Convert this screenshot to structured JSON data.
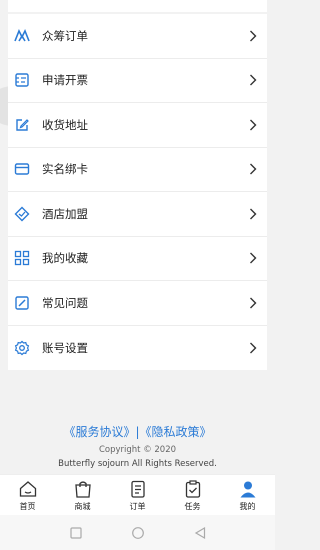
{
  "menu": {
    "items": [
      {
        "label": "众筹订单",
        "icon": "crowdfund-icon"
      },
      {
        "label": "申请开票",
        "icon": "invoice-icon"
      },
      {
        "label": "收货地址",
        "icon": "edit-address-icon"
      },
      {
        "label": "实名绑卡",
        "icon": "card-icon"
      },
      {
        "label": "酒店加盟",
        "icon": "hotel-join-icon"
      },
      {
        "label": "我的收藏",
        "icon": "grid-icon"
      },
      {
        "label": "常见问题",
        "icon": "question-edit-icon"
      },
      {
        "label": "账号设置",
        "icon": "settings-gear-icon"
      }
    ]
  },
  "footer": {
    "links": "《服务协议》|《隐私政策》",
    "copyright": "Copyright © 2020",
    "rights": "Butterfly sojourn All Rights Reserved."
  },
  "tabbar": {
    "tabs": [
      {
        "label": "首页",
        "icon": "home-icon"
      },
      {
        "label": "商城",
        "icon": "shopping-bag-icon"
      },
      {
        "label": "订单",
        "icon": "order-list-icon"
      },
      {
        "label": "任务",
        "icon": "task-clipboard-icon"
      },
      {
        "label": "我的",
        "icon": "user-icon",
        "active": true
      }
    ]
  },
  "colors": {
    "accent": "#2b7bd6",
    "background": "#f2f2f2"
  }
}
